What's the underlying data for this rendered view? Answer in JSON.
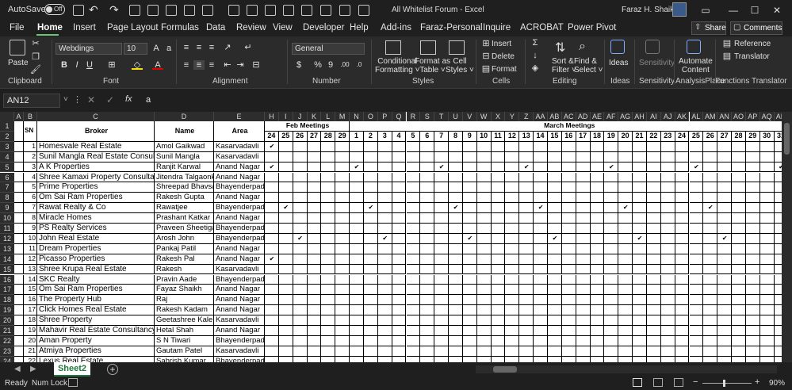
{
  "titlebar": {
    "autosave_label": "AutoSave",
    "autosave_state": "Off",
    "file_title": "All Whitelist Forum  -  Excel",
    "user_name": "Faraz H.  Shaikh"
  },
  "menu": {
    "items": [
      "File",
      "Home",
      "Insert",
      "Page Layout",
      "Formulas",
      "Data",
      "Review",
      "View",
      "Developer",
      "Help",
      "Add-ins",
      "Faraz-Personal",
      "Inquire",
      "ACROBAT",
      "Power Pivot"
    ],
    "active": "Home",
    "share_label": "Share",
    "comments_label": "Comments"
  },
  "ribbon": {
    "paste_label": "Paste",
    "font_name": "Webdings",
    "font_size": "10",
    "number_format": "General",
    "conditional_formatting": "Conditional\nFormatting ˅",
    "format_as_table": "Format as\nTable ˅",
    "cell_styles": "Cell\nStyles ˅",
    "insert": "Insert",
    "delete": "Delete",
    "format": "Format",
    "sort_filter": "Sort &\nFilter ˅",
    "find_select": "Find &\nSelect ˅",
    "ideas": "Ideas",
    "sensitivity": "Sensitivity",
    "automate_content": "Automate\nContent",
    "reference": "Reference",
    "translator": "Translator",
    "groups": [
      "Clipboard",
      "Font",
      "Alignment",
      "Number",
      "Styles",
      "Cells",
      "Editing",
      "Ideas",
      "Sensitivity",
      "AnalysisPlace",
      "Functions Translator"
    ]
  },
  "formula_bar": {
    "name_box": "AN12",
    "formula": "a"
  },
  "sheet": {
    "col_letters": [
      "A",
      "B",
      "C",
      "D",
      "E",
      "F",
      "G",
      "H",
      "I",
      "J",
      "K",
      "L",
      "M",
      "N",
      "O",
      "P",
      "Q",
      "R",
      "S",
      "T",
      "U",
      "V",
      "W",
      "X",
      "Y",
      "Z",
      "AA",
      "AB",
      "AC",
      "AD",
      "AE",
      "AF",
      "AG",
      "AH",
      "AI",
      "AJ",
      "AK",
      "AL",
      "AM",
      "AN",
      "AO",
      "AP",
      "AQ",
      "AR"
    ],
    "visible_col_letters": [
      "A",
      "B",
      "C",
      "D",
      "E",
      "H",
      "I",
      "J",
      "K",
      "L",
      "M",
      "N",
      "O",
      "P",
      "Q",
      "R",
      "S",
      "T",
      "U",
      "V",
      "W",
      "X",
      "Y",
      "Z",
      "AA",
      "AB",
      "AC",
      "AD",
      "AE",
      "AF",
      "AG",
      "AH",
      "AI",
      "AJ",
      "AK",
      "AL",
      "AM",
      "AN",
      "AO",
      "AP",
      "AQ",
      "AR"
    ],
    "header_sn": "SN",
    "header_broker": "Broker",
    "header_name": "Name",
    "header_area": "Area",
    "feb_label": "Feb Meetings",
    "march_label": "March Meetings",
    "feb_days": [
      "24",
      "25",
      "26",
      "27",
      "28",
      "29"
    ],
    "march_days": [
      "1",
      "2",
      "3",
      "4",
      "5",
      "6",
      "7",
      "8",
      "9",
      "10",
      "11",
      "12",
      "13",
      "14",
      "15",
      "16",
      "17",
      "18",
      "19",
      "20",
      "21",
      "22",
      "23",
      "24",
      "25",
      "26",
      "27",
      "28",
      "29",
      "30",
      "31"
    ],
    "rows": [
      {
        "sn": "1",
        "broker": "Homesvale Real Estate",
        "name": "Amol Gaikwad",
        "area": "Kasarvadavli"
      },
      {
        "sn": "2",
        "broker": "Sunil Mangla Real Estate Consultancy",
        "name": "Sunil Mangla",
        "area": "Kasarvadavli"
      },
      {
        "sn": "3",
        "broker": "A K Properties",
        "name": "Ranjit Karwal",
        "area": "Anand Nagar"
      },
      {
        "sn": "4",
        "broker": "Shree Kamaxi Property Consultant",
        "name": "Jitendra Talgaonka",
        "area": "Anand Nagar"
      },
      {
        "sn": "5",
        "broker": "Prime Properties",
        "name": "Shreepad Bhavsar",
        "area": "Bhayenderpada"
      },
      {
        "sn": "6",
        "broker": "Om Sai Ram Properties",
        "name": "Rakesh Gupta",
        "area": "Anand Nagar"
      },
      {
        "sn": "7",
        "broker": "Rawat Realty & Co",
        "name": "Rawatjee",
        "area": "Bhayenderpada"
      },
      {
        "sn": "8",
        "broker": "Miracle Homes",
        "name": "Prashant Katkar",
        "area": "Anand Nagar"
      },
      {
        "sn": "9",
        "broker": "PS Realty Services",
        "name": "Praveen Sheetigar",
        "area": "Bhayenderpada"
      },
      {
        "sn": "10",
        "broker": "John Real Estate",
        "name": "Arosh John",
        "area": "Bhayenderpada"
      },
      {
        "sn": "11",
        "broker": "Dream Properties",
        "name": "Pankaj Patil",
        "area": "Anand Nagar"
      },
      {
        "sn": "12",
        "broker": "Picasso Properties",
        "name": "Rakesh Pal",
        "area": "Anand Nagar"
      },
      {
        "sn": "13",
        "broker": "Shree Krupa Real Estate",
        "name": "Rakesh",
        "area": "Kasarvadavli"
      },
      {
        "sn": "14",
        "broker": "SKC Realty",
        "name": "Pravin Aade",
        "area": "Bhayenderpada"
      },
      {
        "sn": "15",
        "broker": "Om Sai Ram Properties",
        "name": "Fayaz Shaikh",
        "area": "Anand Nagar"
      },
      {
        "sn": "16",
        "broker": "The Property Hub",
        "name": "Raj",
        "area": "Anand Nagar"
      },
      {
        "sn": "17",
        "broker": "Click Homes Real Estate",
        "name": "Rakesh Kadam",
        "area": "Anand Nagar"
      },
      {
        "sn": "18",
        "broker": "Shree Property",
        "name": "Geetashree Kale",
        "area": "Kasarvadavli"
      },
      {
        "sn": "19",
        "broker": "Mahavir Real Estate Consultancy",
        "name": "Hetal Shah",
        "area": "Anand Nagar"
      },
      {
        "sn": "20",
        "broker": "Aman Property",
        "name": "S N Tiwari",
        "area": "Bhayenderpada"
      },
      {
        "sn": "21",
        "broker": "Atmiya Properties",
        "name": "Gautam Patel",
        "area": "Kasarvadavli"
      },
      {
        "sn": "22",
        "broker": "Lexus Real Estate",
        "name": "Sabrish Kumar",
        "area": "Bhayenderpada"
      }
    ],
    "checkmark_glyph": "✔",
    "checks": [
      {
        "row": 1,
        "cols": [
          0
        ]
      },
      {
        "row": 3,
        "cols": [
          0,
          6,
          12,
          18,
          24,
          30,
          36
        ]
      },
      {
        "row": 7,
        "cols": [
          1,
          7,
          13,
          19,
          25,
          31
        ]
      },
      {
        "row": 10,
        "cols": [
          2,
          8,
          14,
          20,
          26,
          32
        ]
      },
      {
        "row": 12,
        "cols": [
          0
        ]
      }
    ]
  },
  "tabs": {
    "sheet_name": "Sheet2",
    "add_label": "+"
  },
  "status": {
    "ready": "Ready",
    "numlock": "Num Lock",
    "zoom": "90%"
  }
}
